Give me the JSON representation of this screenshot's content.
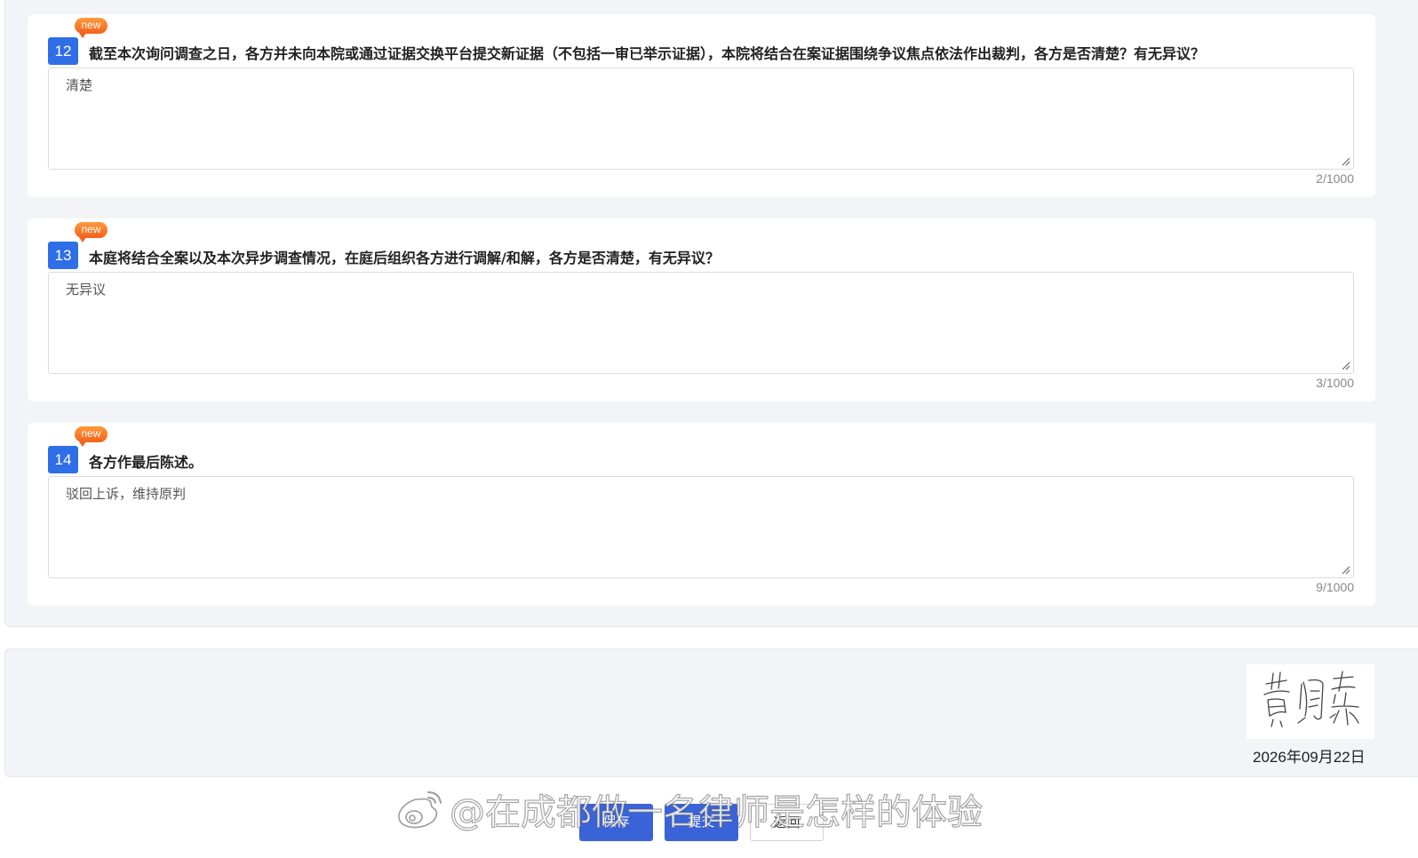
{
  "questions": [
    {
      "badge": "new",
      "number": "12",
      "text": "截至本次询问调查之日，各方并未向本院或通过证据交换平台提交新证据（不包括一审已举示证据），本院将结合在案证据围绕争议焦点依法作出裁判，各方是否清楚？有无异议？",
      "answer": "清楚",
      "count": "2/1000"
    },
    {
      "badge": "new",
      "number": "13",
      "text": "本庭将结合全案以及本次异步调查情况，在庭后组织各方进行调解/和解，各方是否清楚，有无异议？",
      "answer": "无异议",
      "count": "3/1000"
    },
    {
      "badge": "new",
      "number": "14",
      "text": "各方作最后陈述。",
      "answer": "驳回上诉，维持原判",
      "count": "9/1000"
    }
  ],
  "signature": {
    "date": "2026年09月22日"
  },
  "footer": {
    "buttons": [
      "保存",
      "提交",
      "返回"
    ]
  },
  "watermark": {
    "text": "@在成都做一名律师是怎样的体验"
  },
  "colors": {
    "accent": "#2f6ee6",
    "badge": "#f2621a",
    "button_primary": "#3a63d8",
    "panel_bg": "#f3f4f8"
  }
}
